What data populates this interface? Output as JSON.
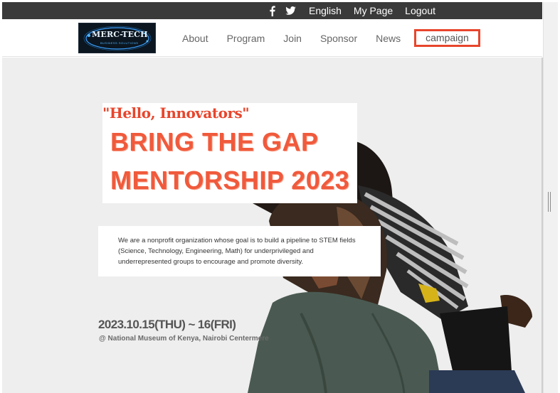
{
  "topbar": {
    "social": [
      "facebook-icon",
      "twitter-icon"
    ],
    "links": [
      "English",
      "My Page",
      "Logout"
    ]
  },
  "navbar": {
    "logo": {
      "text": "MERC-TECH",
      "subtext": "BUSINESS SOLUTIONS"
    },
    "items": [
      "About",
      "Program",
      "Join",
      "Sponsor",
      "News",
      "campaign"
    ],
    "highlight_color": "#e8452c"
  },
  "hero": {
    "greeting": "\"Hello, Innovators\"",
    "headline_line1": "BRING THE GAP",
    "headline_line2": "MENTORSHIP 2023",
    "description": "We are a nonprofit organization whose goal is to build a pipeline to STEM fields (Science, Technology, Engineering, Math) for underprivileged and underrepresented groups to encourage and promote diversity.",
    "date": "2023.10.15(THU) ~ 16(FRI)",
    "venue": "@ National Museum of Kenya, Nairobi Centermere",
    "accent_color": "#f05a3c"
  }
}
